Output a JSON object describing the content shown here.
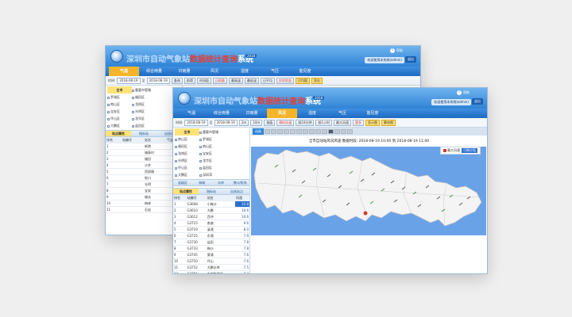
{
  "app": {
    "title_prefix": "深圳市自动气象站",
    "title_highlight": "数据统计查询",
    "title_suffix": "系统",
    "version_badge": "2018",
    "help_text": "帮助",
    "user_info": "欢迎使用本系统(admin)",
    "exit_label": "退出"
  },
  "nav": {
    "tabs": [
      "气温",
      "综合雨量",
      "日雨量",
      "风况",
      "湿度",
      "气压",
      "能见度"
    ]
  },
  "back": {
    "active_tab": 0,
    "toolbar": {
      "buttons": [
        "查询",
        "前滑",
        "时间段",
        "日雨量",
        "最高温",
        "最低温",
        "日平均",
        "实时状态",
        "日均值",
        "导出"
      ]
    },
    "regions": [
      "全市",
      "重要市管辖",
      "罗湖区",
      "福田区",
      "南山区",
      "龙岗区",
      "宝安区",
      "光明区",
      "坪山区",
      "龙华区",
      "大鹏区",
      "盐田区"
    ],
    "panel_headers": [
      "站点属性",
      "指标站",
      "自选站"
    ],
    "table_headers": [
      "排名",
      "站编号",
      "站名",
      "气温"
    ],
    "rows": [
      {
        "rank": "1",
        "code": "",
        "name": "新港",
        "value": "31."
      },
      {
        "rank": "2",
        "code": "",
        "name": "福泰村",
        "value": "31."
      },
      {
        "rank": "3",
        "code": "",
        "name": "福田",
        "value": "31."
      },
      {
        "rank": "4",
        "code": "",
        "name": "沙井",
        "value": "31."
      },
      {
        "rank": "5",
        "code": "",
        "name": "西丽塘",
        "value": "31."
      },
      {
        "rank": "6",
        "code": "",
        "name": "蛇口",
        "value": "31."
      },
      {
        "rank": "7",
        "code": "",
        "name": "光明",
        "value": "31."
      },
      {
        "rank": "8",
        "code": "",
        "name": "宝安",
        "value": "31."
      },
      {
        "rank": "9",
        "code": "",
        "name": "福永",
        "value": "31."
      },
      {
        "rank": "10",
        "code": "",
        "name": "梅林",
        "value": "31."
      },
      {
        "rank": "11",
        "code": "",
        "name": "石岩",
        "value": "31."
      }
    ]
  },
  "front": {
    "active_tab": 3,
    "toolbar": {
      "time_label": "时间:",
      "time_value": "2018-08-19",
      "to_label": "至",
      "buttons": [
        "2m",
        "10m",
        "极值",
        "瞬时风速",
        "前10分钟",
        "前1小时",
        "最大风速",
        "更多",
        "显示图",
        "静态图"
      ]
    },
    "regions": [
      "全市",
      "重要市管辖",
      "南山区",
      "罗湖区",
      "福田区",
      "南山区",
      "龙岗区",
      "宝安区",
      "光明区",
      "龙华区",
      "坪山区",
      "盐田区",
      "大鹏区",
      "深圳湾"
    ],
    "area_tabs": [
      "县级区",
      "海域",
      "水库",
      "港口/机场"
    ],
    "panel_headers": [
      "站点属性",
      "指标站",
      "自选站点"
    ],
    "table_headers": [
      "排名",
      "站编号",
      "站名",
      "风速"
    ],
    "rows": [
      {
        "rank": "1",
        "code": "G3608",
        "name": "小梅沙",
        "value": "12.8"
      },
      {
        "rank": "2",
        "code": "G3610",
        "name": "大鹏",
        "value": "10.6"
      },
      {
        "rank": "3",
        "code": "G3612",
        "name": "西冲",
        "value": "10.6"
      },
      {
        "rank": "4",
        "code": "G3715",
        "name": "南澳",
        "value": "9.6"
      },
      {
        "rank": "5",
        "code": "G3719",
        "name": "溪涌",
        "value": "8.0"
      },
      {
        "rank": "6",
        "code": "G3725",
        "name": "东涌",
        "value": "7.9"
      },
      {
        "rank": "7",
        "code": "G3730",
        "name": "盐田",
        "value": "7.8"
      },
      {
        "rank": "8",
        "code": "G3733",
        "name": "梅沙",
        "value": "7.8"
      },
      {
        "rank": "9",
        "code": "G3745",
        "name": "葵涌",
        "value": "7.6"
      },
      {
        "rank": "10",
        "code": "G3750",
        "name": "坪山",
        "value": "7.6"
      },
      {
        "rank": "11",
        "code": "G3752",
        "name": "大鹏水库",
        "value": "7.5"
      },
      {
        "rank": "12",
        "code": "G3761",
        "name": "东部华侨城",
        "value": "7.4"
      },
      {
        "rank": "13",
        "code": "G3766",
        "name": "沙头角",
        "value": "7.4"
      },
      {
        "rank": "14",
        "code": "G3770",
        "name": "三洲田",
        "value": "7.3"
      },
      {
        "rank": "15",
        "code": "G3778",
        "name": "马峦",
        "value": "7.3"
      }
    ],
    "map": {
      "anim_label": "动画",
      "title": "全市自动站风况风速    数据时段: 2018-08-19 10:00 到 2018-08-19 11:00",
      "legend_label": "最大风速",
      "legend_option": "小梅沙站",
      "land_color": "#f4f4f4",
      "sea_color": "#6aa2e8",
      "border_color": "#bdbdbd"
    }
  }
}
